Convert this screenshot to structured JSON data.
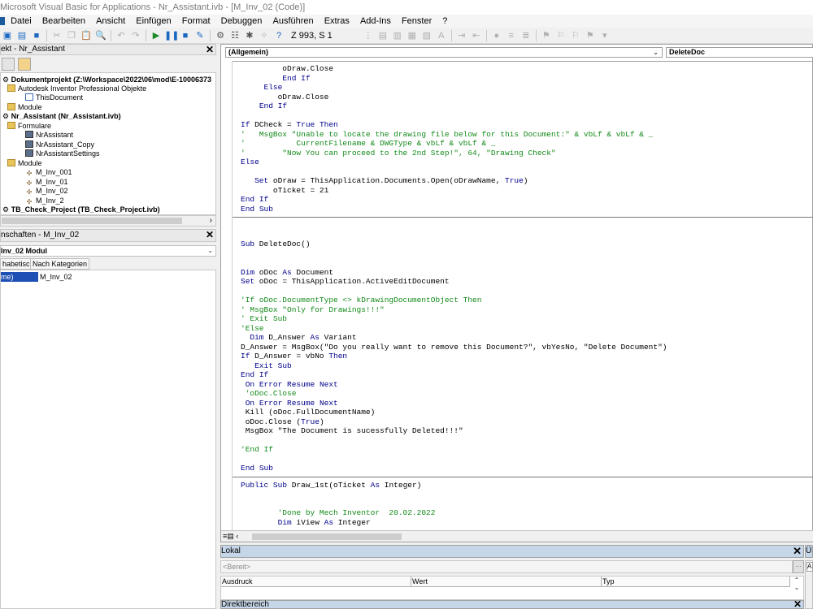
{
  "window": {
    "title": "Microsoft Visual Basic for Applications - Nr_Assistant.ivb - [M_Inv_02 (Code)]"
  },
  "menu": [
    "Datei",
    "Bearbeiten",
    "Ansicht",
    "Einfügen",
    "Format",
    "Debuggen",
    "Ausführen",
    "Extras",
    "Add-Ins",
    "Fenster",
    "?"
  ],
  "toolbar": {
    "position_label": "Z 993, S 1"
  },
  "project": {
    "title": "ekt - Nr_Assistant",
    "tree": [
      {
        "label": "Dokumentprojekt (Z:\\Workspace\\2022\\06\\mod\\E-10006373",
        "level": 0,
        "bold": true,
        "icon": "vba-project-icon"
      },
      {
        "label": "Autodesk Inventor Professional Objekte",
        "level": 1,
        "icon": "folder-icon"
      },
      {
        "label": "ThisDocument",
        "level": 2,
        "icon": "document-icon"
      },
      {
        "label": "Module",
        "level": 1,
        "icon": "folder-icon"
      },
      {
        "label": "Nr_Assistant (Nr_Assistant.ivb)",
        "level": 0,
        "bold": true,
        "icon": "vba-project-icon"
      },
      {
        "label": "Formulare",
        "level": 1,
        "icon": "folder-icon"
      },
      {
        "label": "NrAssistant",
        "level": 2,
        "icon": "userform-icon"
      },
      {
        "label": "NrAssistant_Copy",
        "level": 2,
        "icon": "userform-icon"
      },
      {
        "label": "NrAssistantSettings",
        "level": 2,
        "icon": "userform-icon"
      },
      {
        "label": "Module",
        "level": 1,
        "icon": "folder-icon"
      },
      {
        "label": "M_Inv_001",
        "level": 2,
        "icon": "module-icon"
      },
      {
        "label": "M_Inv_01",
        "level": 2,
        "icon": "module-icon"
      },
      {
        "label": "M_Inv_02",
        "level": 2,
        "icon": "module-icon"
      },
      {
        "label": "M_Inv_2",
        "level": 2,
        "icon": "module-icon"
      },
      {
        "label": "TB_Check_Project (TB_Check_Project.ivb)",
        "level": 0,
        "bold": true,
        "icon": "vba-project-icon"
      }
    ]
  },
  "properties": {
    "title": "nschaften - M_Inv_02",
    "object_select": "Inv_02 Modul",
    "tabs": [
      "habetisch",
      "Nach Kategorien"
    ],
    "rows": [
      {
        "key": "me)",
        "value": "M_Inv_02"
      }
    ]
  },
  "code": {
    "object_combo": "(Allgemein)",
    "procedure_combo": "DeleteDoc",
    "lines": [
      "         oDraw.Close",
      "         End If",
      "     Else",
      "        oDraw.Close",
      "    End If",
      "",
      "If DCheck = True Then",
      "'   MsgBox \"Unable to locate the drawing file below for this Document:\" & vbLf & vbLf & _",
      "'           CurrentFilename & DWGType & vbLf & vbLf & _",
      "'        \"Now You can proceed to the 2nd Step!\", 64, \"Drawing Check\"",
      "Else",
      "",
      "   Set oDraw = ThisApplication.Documents.Open(oDrawName, True)",
      "       oTicket = 21",
      "End If",
      "End Sub",
      "---",
      "",
      "",
      "Sub DeleteDoc()",
      "",
      "",
      "Dim oDoc As Document",
      "Set oDoc = ThisApplication.ActiveEditDocument",
      "",
      "'If oDoc.DocumentType <> kDrawingDocumentObject Then",
      "' MsgBox \"Only for Drawings!!!\"",
      "' Exit Sub",
      "'Else",
      "  Dim D_Answer As Variant",
      "D_Answer = MsgBox(\"Do you really want to remove this Document?\", vbYesNo, \"Delete Document\")",
      "If D_Answer = vbNo Then",
      "   Exit Sub",
      "End If",
      " On Error Resume Next",
      " 'oDoc.Close",
      " On Error Resume Next",
      " Kill (oDoc.FullDocumentName)",
      " oDoc.Close (True)",
      " MsgBox \"The Document is sucessfully Deleted!!!\"",
      "",
      "'End If",
      "",
      "End Sub",
      "---",
      "Public Sub Draw_1st(oTicket As Integer)",
      "",
      "",
      "        'Done by Mech Inventor  20.02.2022",
      "        Dim iView As Integer"
    ]
  },
  "lokal": {
    "title": "Lokal",
    "context": "<Bereit>",
    "columns": [
      "Ausdruck",
      "Wert",
      "Typ"
    ]
  },
  "direkt": {
    "title": "Direktbereich"
  },
  "ueberwachung": {
    "title": "Üb",
    "sub": "A"
  }
}
